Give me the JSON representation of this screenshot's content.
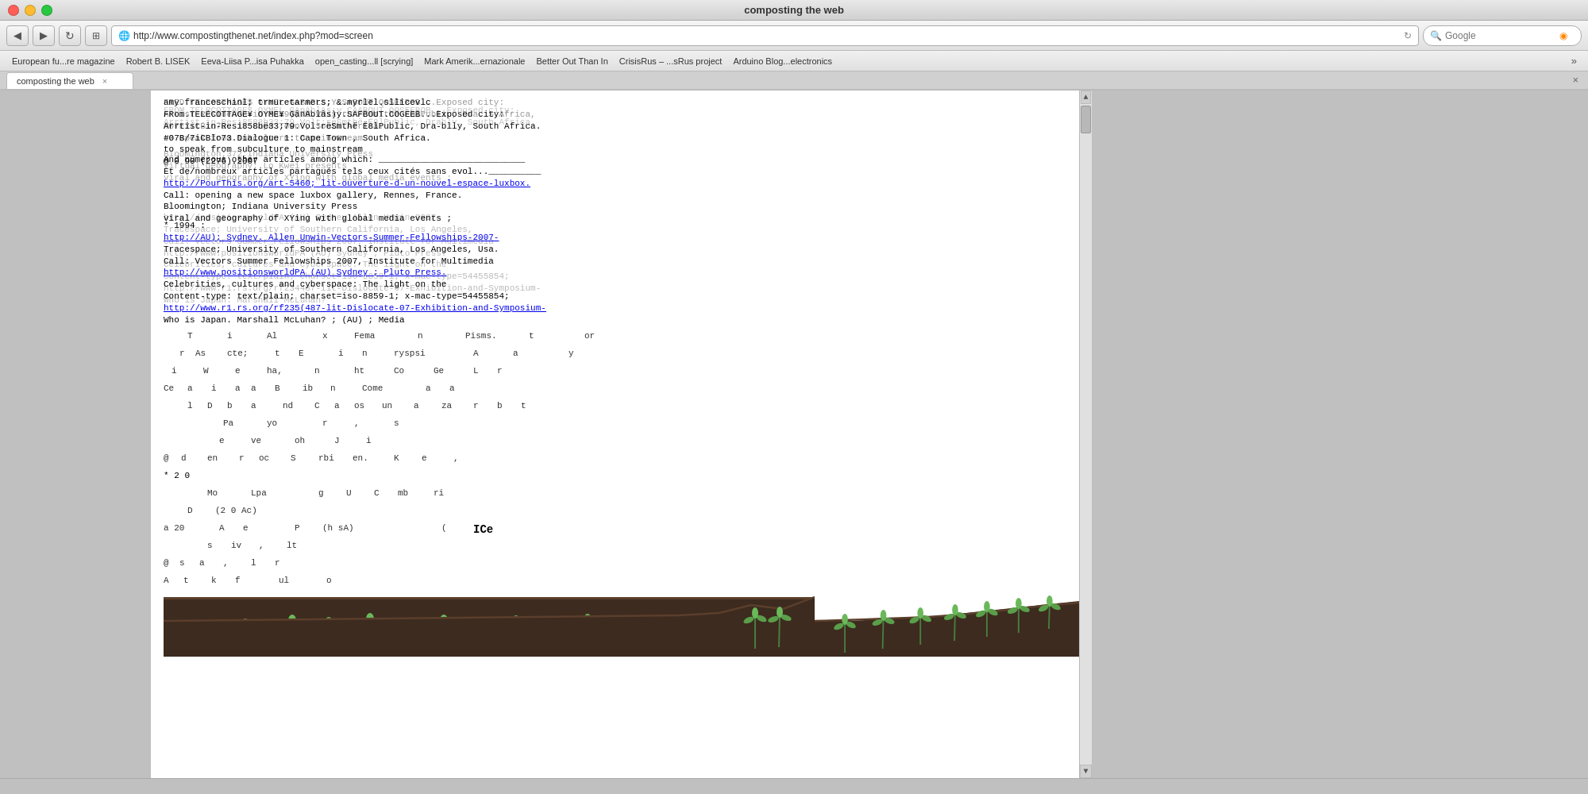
{
  "window": {
    "title": "composting the web",
    "close_btn": "×",
    "min_btn": "−",
    "max_btn": "+"
  },
  "navbar": {
    "back_btn": "◀",
    "forward_btn": "▶",
    "url": "http://www.compostingthenet.net/index.php?mod=screen",
    "search_placeholder": "Google",
    "reload_btn": "↻"
  },
  "bookmarks": [
    "European fu...re magazine",
    "Robert B. LISEK",
    "Eeva-Liisa P...isa Puhakka",
    "open_casting...ll [scrying]",
    "Mark Amerik...ernazionale",
    "Better Out Than In",
    "CrisisRus – ...sRus project",
    "Arduino Blog...electronics"
  ],
  "tab": {
    "label": "composting the web",
    "close": "×"
  },
  "content": {
    "overlapping_lines": [
      "amy.franceschinl; trmuretarmers; &.myrlel.sllicevlc",
      "FRom.TELECOTTAGE¥ OYME¥ GânAblâs)y.SAFBOUT.COGEEB...Exposed city:",
      "Arrtist-in-Resi858bë33;79.Vol:rëSmthë Ë8lPublic, Dra-blly, South Africa.",
      "#07B/7iCBlo73.Dialogue 1: Cape Town , South Africa.",
      "to speak from subculture to mainstream",
      "@ 0 90 (2276).2007",
      "",
      "And numerous other articles among which:",
      "Et.de/nombreux.articles.partagés.tels.ceux.cités.sans.evolution...",
      "http://PourThis.org/art-5460; lit-ouverture-d-un-nouvel-espace-luxbox.",
      "Call: opening a new space luxbox gallery, Rennes, France.",
      "Bloomington; Indiana University Press",
      "virtual geography; Lo Kwei presents",
      "viral and geography of XYing with global media events ;",
      "* 1994 :",
      "http://AU); Sydney. Allen Unwin-Vectors-Summer-Fellowships-2007-",
      "Tracespace; University of Southern California, Los Angeles, Usa.",
      "Call: Vectors Summer Fellowships 2007, Institute for Multimedia",
      "http://www.positionsworldPA (AU) Sydney ; Pluto Press.",
      "Celebrities, cultures and cyberspace: The light on the",
      "Content-type: text/plain; charset=iso-8859-1; x-mac-type=54455854;",
      "http://www.r1.rs.org/rf235(487-lit-Dislocate-07-Exhibition-and-Symposium-",
      "Who is Japan. Marshall McLuhan? ; (AU) ; Media",
      "* 2000 :"
    ],
    "scattered_text": "This Al Fema n Pisms. t or\n r As cte; t E i n ryspsi A a y\n i W e ha, n ht Co Ge L r\nCe a i a a B ib n Come a a\n l D b a nd C a os un a za r b t\n Pa yo r , s\n e ve oh J i\n@ d en r oc S rbi en. K e ,\n* 2 0\n Mo Lpa g U C mb ri\n D (20 Az )\na 20 A e P (h sA) ( K\n s iv , lt\n@ s a , l r\nA t k f ul o",
    "year_markers": [
      "* 1994 :",
      "* 2000 :",
      "* 2 0"
    ],
    "ice_text": "ICe"
  },
  "plants": {
    "count": 20,
    "soil_color": "#3d2b1f",
    "stem_color": "#4a7c3f",
    "leaf_color": "#5a9e4a"
  },
  "colors": {
    "background": "#c0c0c0",
    "browser_bg": "white",
    "address_bar_bg": "white",
    "tab_bg": "white",
    "bookmarks_bar": "#e8e8e8",
    "nav_bar": "#ebebeb",
    "title_bar": "#e0e0e0",
    "close_btn": "#ff5f57",
    "min_btn": "#febc2e",
    "max_btn": "#28c840",
    "scrollbar": "#e0e0e0",
    "scrollbar_thumb": "#b0b0b0",
    "text": "#000000",
    "link": "#0000ee"
  }
}
